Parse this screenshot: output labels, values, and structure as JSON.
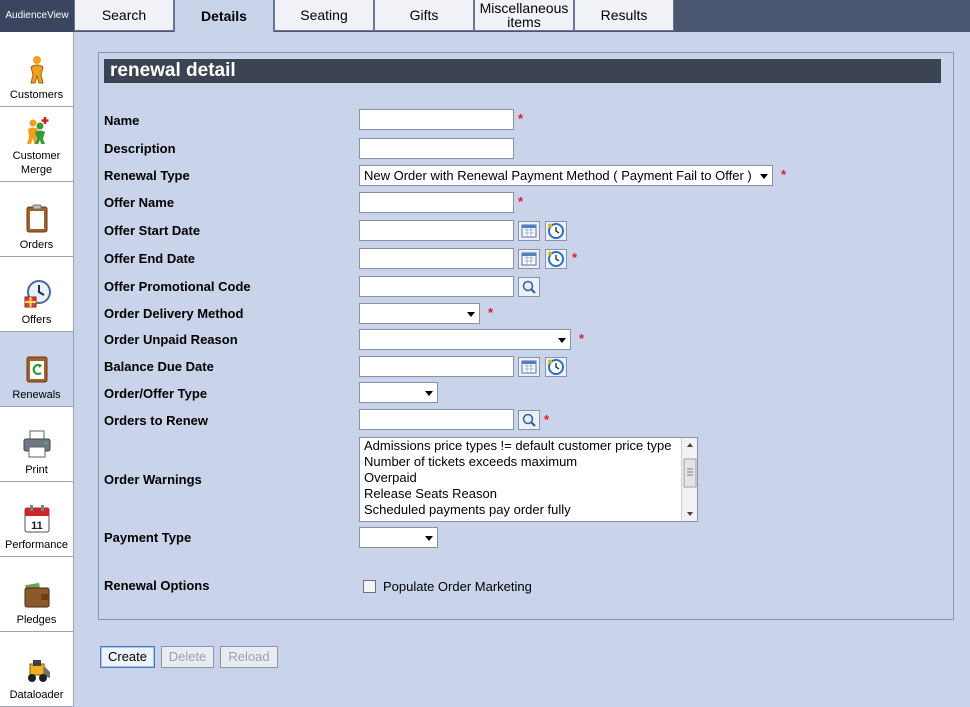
{
  "app": {
    "brand": "AudienceView"
  },
  "tabs": [
    {
      "label": "Search"
    },
    {
      "label": "Details"
    },
    {
      "label": "Seating"
    },
    {
      "label": "Gifts"
    },
    {
      "label": "Miscellaneous items"
    },
    {
      "label": "Results"
    }
  ],
  "sidebar": {
    "items": [
      {
        "label": "Customers",
        "icon": "customer-icon"
      },
      {
        "label": "Customer Merge",
        "icon": "customer-merge-icon"
      },
      {
        "label": "Orders",
        "icon": "orders-icon"
      },
      {
        "label": "Offers",
        "icon": "offers-icon"
      },
      {
        "label": "Renewals",
        "icon": "renewals-icon"
      },
      {
        "label": "Print",
        "icon": "printer-icon"
      },
      {
        "label": "Performance",
        "icon": "calendar-icon"
      },
      {
        "label": "Pledges",
        "icon": "wallet-icon"
      },
      {
        "label": "Dataloader",
        "icon": "loader-icon"
      }
    ]
  },
  "panel": {
    "title": "renewal detail"
  },
  "form": {
    "name": {
      "label": "Name",
      "value": ""
    },
    "description": {
      "label": "Description",
      "value": ""
    },
    "renewal_type": {
      "label": "Renewal Type",
      "value": "New Order with Renewal Payment Method ( Payment Fail to Offer )"
    },
    "offer_name": {
      "label": "Offer Name",
      "value": ""
    },
    "offer_start_date": {
      "label": "Offer Start Date",
      "value": ""
    },
    "offer_end_date": {
      "label": "Offer End Date",
      "value": ""
    },
    "offer_promo_code": {
      "label": "Offer Promotional Code",
      "value": ""
    },
    "order_delivery_method": {
      "label": "Order Delivery Method",
      "value": ""
    },
    "order_unpaid_reason": {
      "label": "Order Unpaid Reason",
      "value": ""
    },
    "balance_due_date": {
      "label": "Balance Due Date",
      "value": ""
    },
    "order_offer_type": {
      "label": "Order/Offer Type",
      "value": ""
    },
    "orders_to_renew": {
      "label": "Orders to Renew",
      "value": ""
    },
    "order_warnings": {
      "label": "Order Warnings",
      "options": [
        "Admissions price types != default customer price type",
        "Number of tickets exceeds maximum",
        "Overpaid",
        "Release Seats Reason",
        "Scheduled payments pay order fully"
      ]
    },
    "payment_type": {
      "label": "Payment Type",
      "value": ""
    },
    "renewal_options": {
      "label": "Renewal Options",
      "populate_label": "Populate Order Marketing",
      "populate_checked": false
    },
    "required_mark": "*"
  },
  "buttons": {
    "create": "Create",
    "delete": "Delete",
    "reload": "Reload"
  },
  "colors": {
    "required": "#e0182c",
    "title_bar": "#3c4454",
    "background": "#c9d3e9"
  }
}
